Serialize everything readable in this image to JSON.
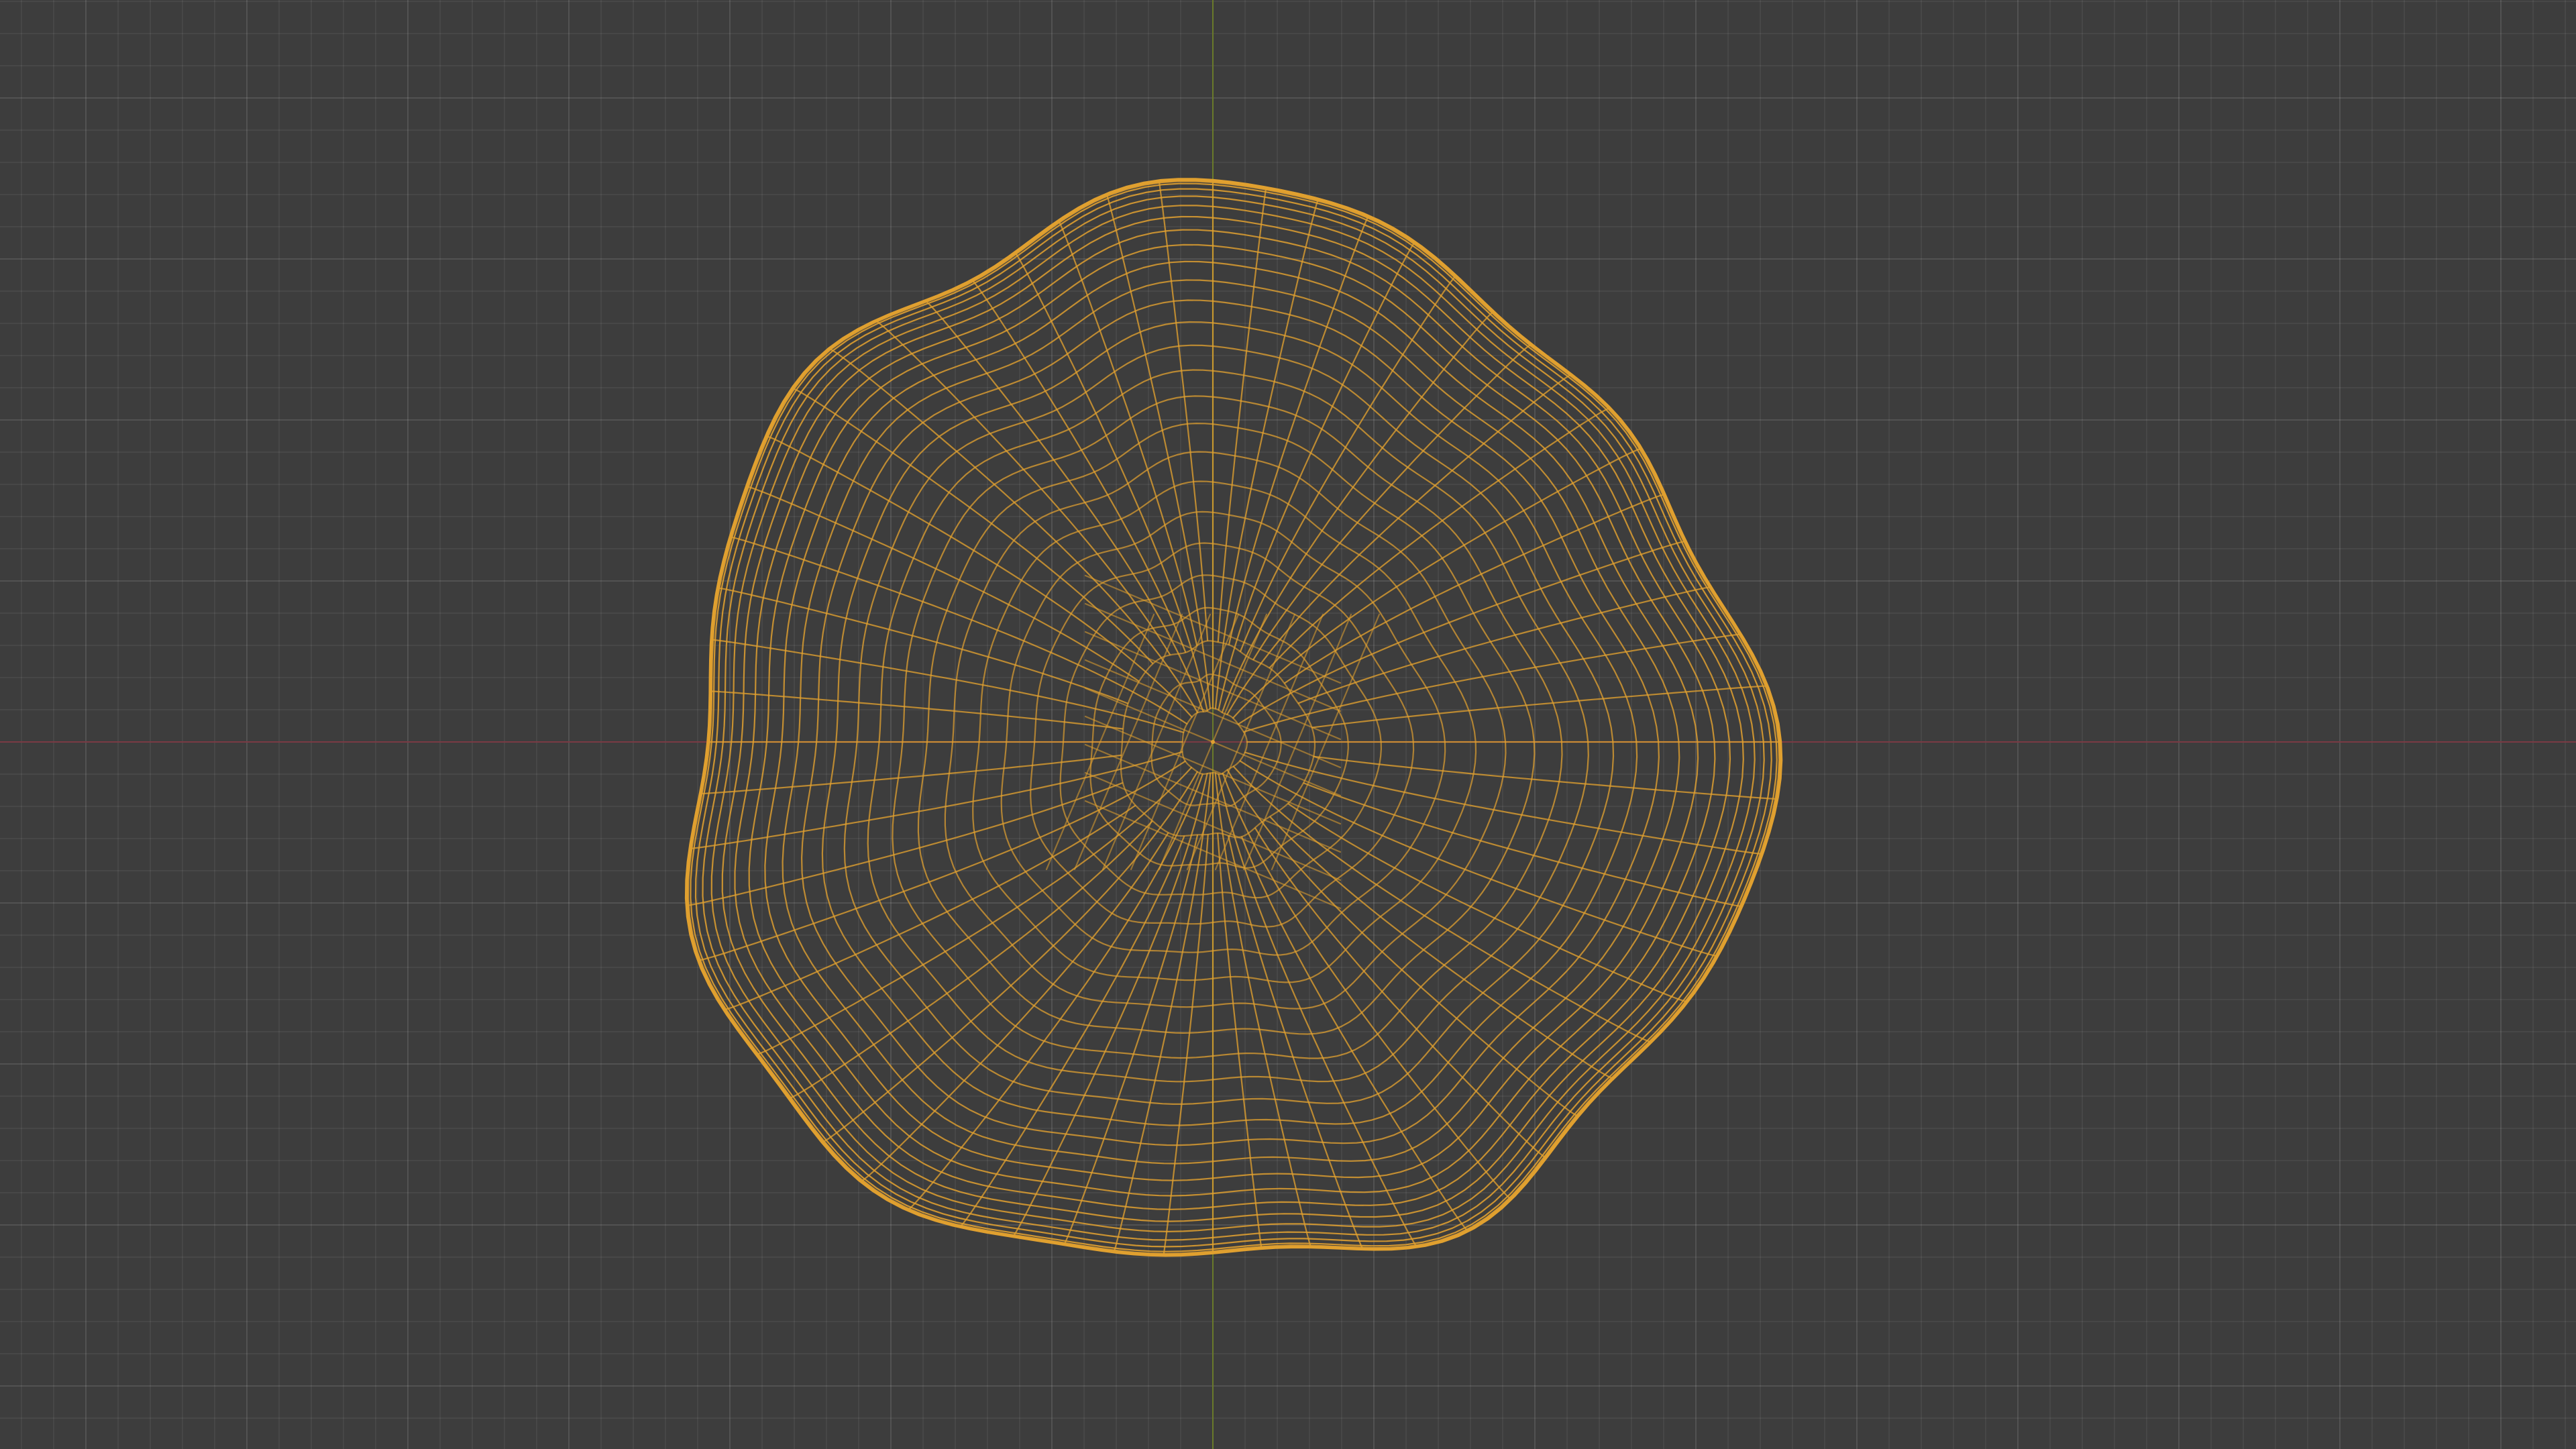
{
  "viewport": {
    "background_color": "#3d3d3d",
    "x_axis_color": "#7a3a44",
    "y_axis_color": "#6a7a2a",
    "mesh_color": "#e0a030",
    "grid_color": "#4a4a4a",
    "shading_mode": "wireframe",
    "selected_object": "sphere-mesh",
    "selection_state": "selected"
  }
}
